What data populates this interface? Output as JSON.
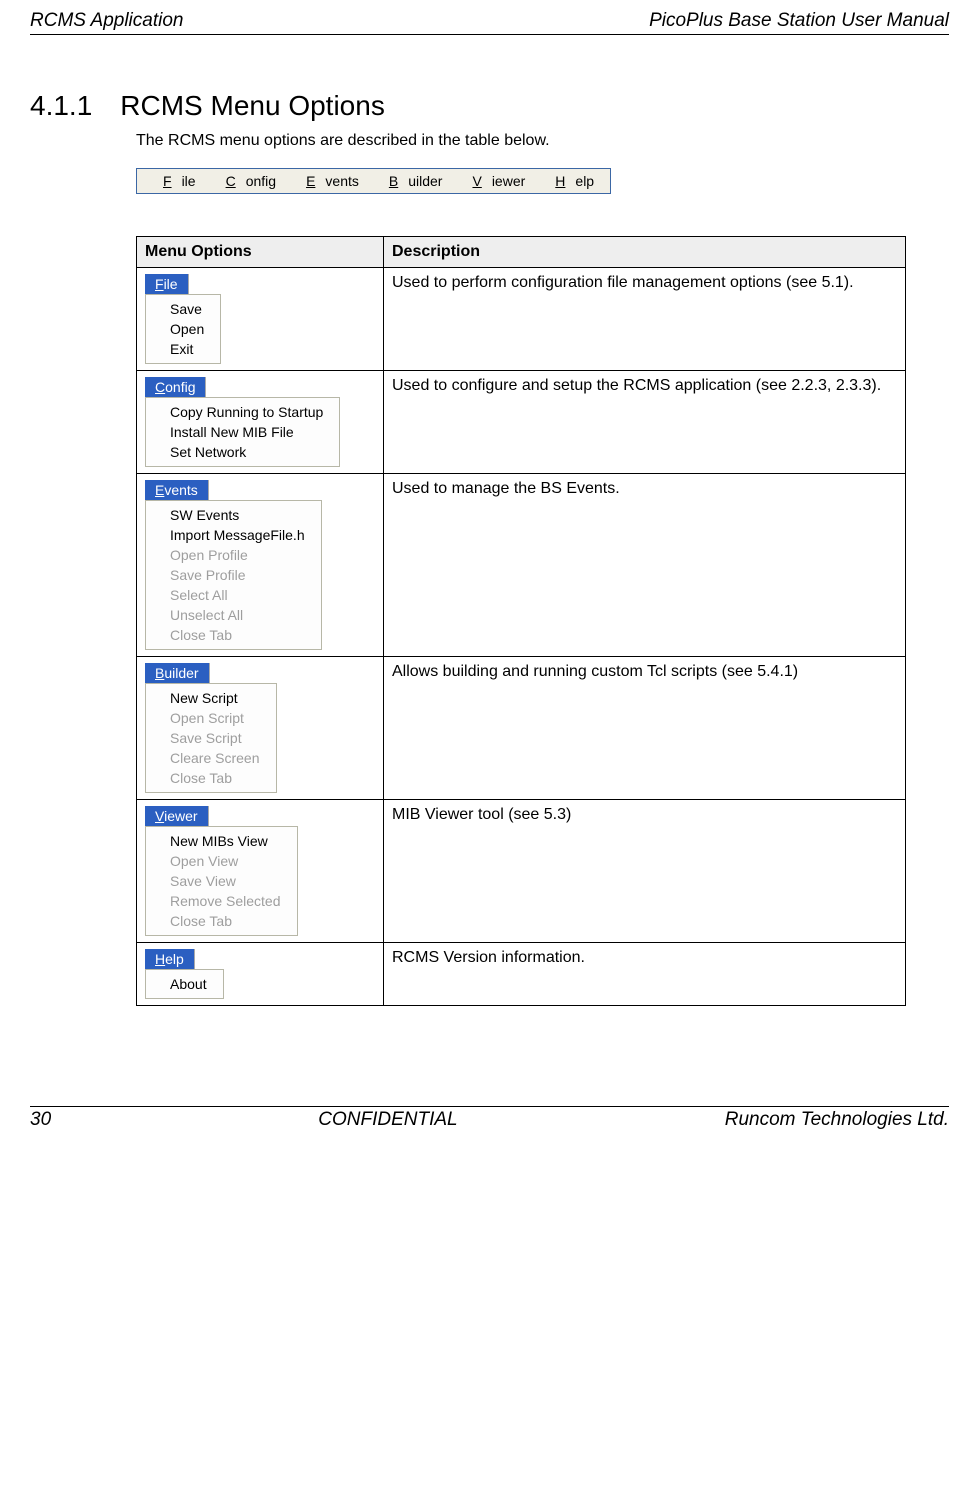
{
  "header": {
    "left": "RCMS Application",
    "right": "PicoPlus Base Station User Manual"
  },
  "section": {
    "number": "4.1.1",
    "title": "RCMS Menu Options"
  },
  "intro": "The RCMS menu options are described in the table below.",
  "menubar": {
    "items": [
      "File",
      "Config",
      "Events",
      "Builder",
      "Viewer",
      "Help"
    ]
  },
  "table": {
    "headers": [
      "Menu Options",
      "Description"
    ],
    "rows": [
      {
        "menu": {
          "top": "File",
          "items": [
            {
              "label": "Save",
              "disabled": false
            },
            {
              "label": "Open",
              "disabled": false
            },
            {
              "label": "Exit",
              "disabled": false
            }
          ]
        },
        "desc": "Used to perform configuration file management options (see 5.1)."
      },
      {
        "menu": {
          "top": "Config",
          "items": [
            {
              "label": "Copy Running to Startup",
              "disabled": false
            },
            {
              "label": "Install New MIB File",
              "disabled": false
            },
            {
              "label": "Set Network",
              "disabled": false
            }
          ]
        },
        "desc": "Used to configure and setup the RCMS application (see 2.2.3, 2.3.3)."
      },
      {
        "menu": {
          "top": "Events",
          "items": [
            {
              "label": "SW Events",
              "disabled": false
            },
            {
              "label": "Import MessageFile.h",
              "disabled": false
            },
            {
              "label": "Open Profile",
              "disabled": true
            },
            {
              "label": "Save Profile",
              "disabled": true
            },
            {
              "label": "Select All",
              "disabled": true
            },
            {
              "label": "Unselect All",
              "disabled": true
            },
            {
              "label": "Close Tab",
              "disabled": true
            }
          ]
        },
        "desc": "Used to manage the BS Events."
      },
      {
        "menu": {
          "top": "Builder",
          "items": [
            {
              "label": "New Script",
              "disabled": false
            },
            {
              "label": "Open Script",
              "disabled": true
            },
            {
              "label": "Save Script",
              "disabled": true
            },
            {
              "label": "Cleare Screen",
              "disabled": true
            },
            {
              "label": "Close Tab",
              "disabled": true
            }
          ]
        },
        "desc": "Allows building and running custom Tcl scripts (see 5.4.1)"
      },
      {
        "menu": {
          "top": "Viewer",
          "items": [
            {
              "label": "New MIBs View",
              "disabled": false
            },
            {
              "label": "Open View",
              "disabled": true
            },
            {
              "label": "Save View",
              "disabled": true
            },
            {
              "label": "Remove Selected",
              "disabled": true
            },
            {
              "label": "Close Tab",
              "disabled": true
            }
          ]
        },
        "desc": "MIB Viewer tool (see 5.3)"
      },
      {
        "menu": {
          "top": "Help",
          "items": [
            {
              "label": "About",
              "disabled": false
            }
          ]
        },
        "desc": "RCMS Version information."
      }
    ]
  },
  "footer": {
    "left": "30",
    "center": "CONFIDENTIAL",
    "right": "Runcom Technologies Ltd."
  }
}
